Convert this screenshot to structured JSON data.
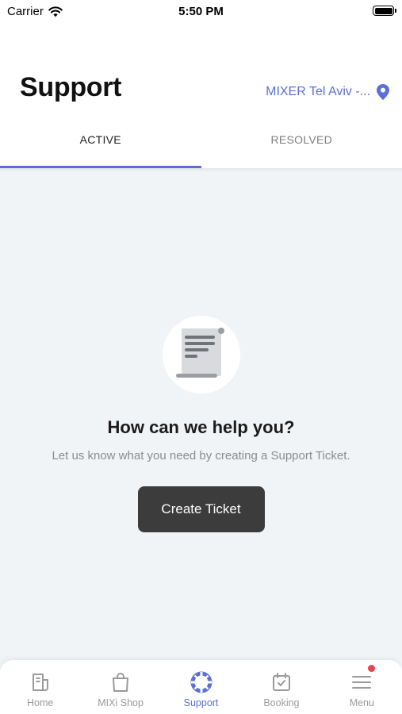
{
  "status_bar": {
    "carrier": "Carrier",
    "time": "5:50 PM"
  },
  "header": {
    "title": "Support",
    "location": "MIXER Tel Aviv -..."
  },
  "tabs": [
    {
      "label": "ACTIVE",
      "active": true
    },
    {
      "label": "RESOLVED",
      "active": false
    }
  ],
  "empty_state": {
    "icon": "scroll-document-icon",
    "title": "How can we help you?",
    "subtitle": "Let us know what you need by creating a Support Ticket.",
    "button_label": "Create Ticket"
  },
  "tab_bar": [
    {
      "label": "Home",
      "icon": "home-icon"
    },
    {
      "label": "MIXi Shop",
      "icon": "shopping-bag-icon"
    },
    {
      "label": "Support",
      "icon": "lifebuoy-icon",
      "active": true
    },
    {
      "label": "Booking",
      "icon": "calendar-check-icon"
    },
    {
      "label": "Menu",
      "icon": "menu-icon",
      "badge": true
    }
  ],
  "colors": {
    "accent": "#5b6fd6",
    "button": "#3c3c3c",
    "background": "#f1f4f7",
    "badge": "#e5434f"
  }
}
